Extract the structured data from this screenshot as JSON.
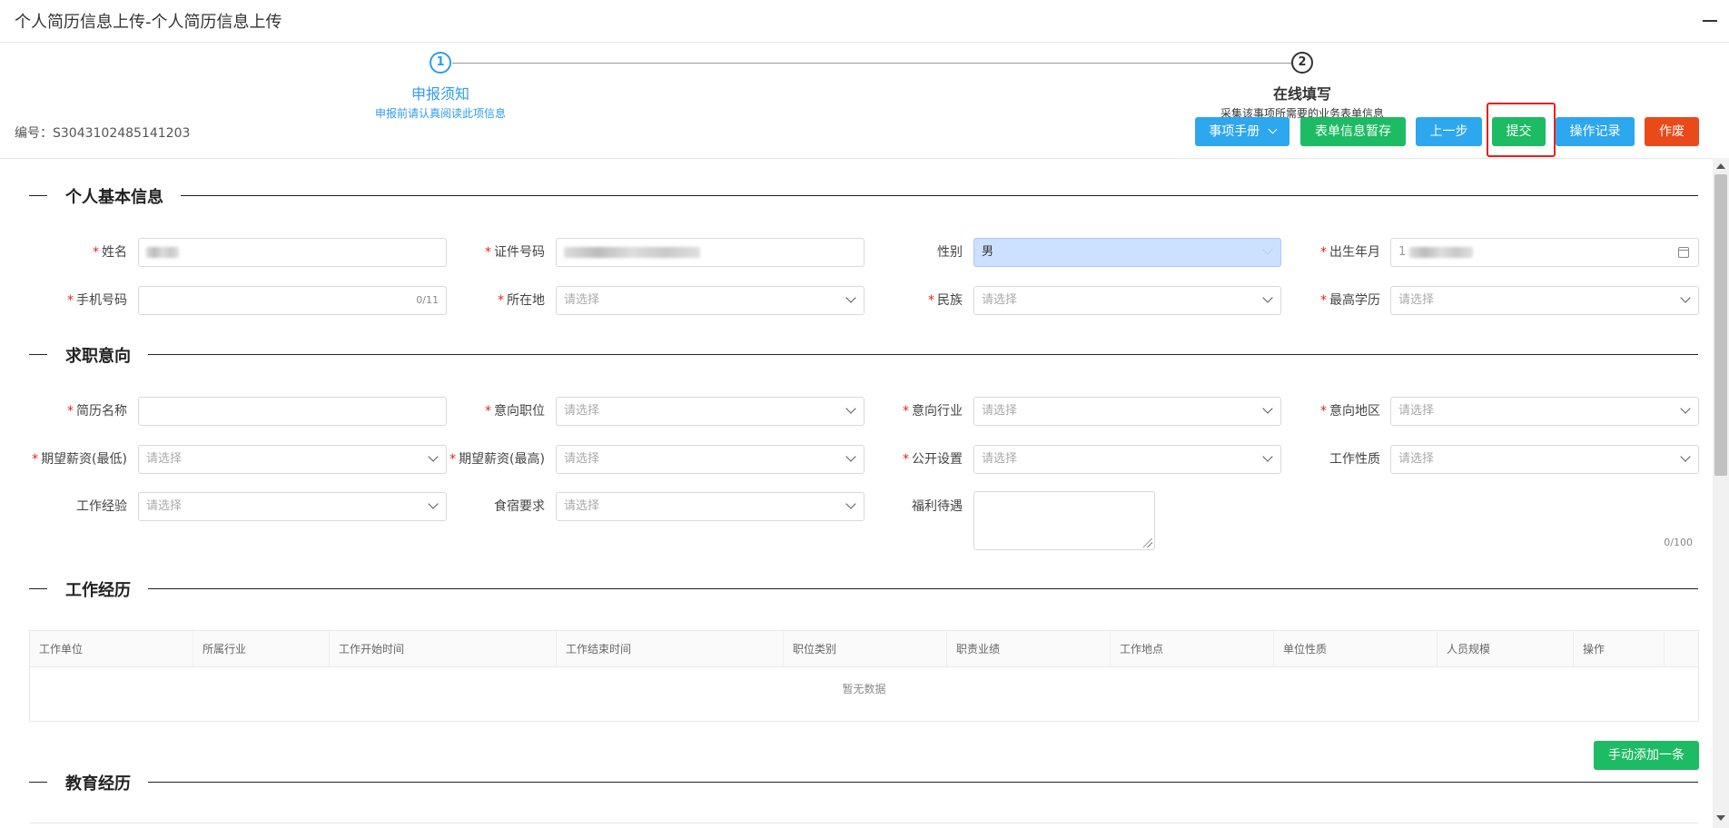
{
  "window": {
    "title": "个人简历信息上传-个人简历信息上传"
  },
  "steps": [
    {
      "num": "1",
      "title": "申报须知",
      "desc": "申报前请认真阅读此项信息"
    },
    {
      "num": "2",
      "title": "在线填写",
      "desc": "采集该事项所需要的业务表单信息"
    }
  ],
  "serial": "编号：S3043102485141203",
  "toolbar": {
    "manual": "事项手册",
    "save": "表单信息暂存",
    "prev": "上一步",
    "submit": "提交",
    "log": "操作记录",
    "void": "作废"
  },
  "placeholder": "请选择",
  "sections": {
    "basic": "个人基本信息",
    "intent": "求职意向",
    "work": "工作经历",
    "education": "教育经历"
  },
  "basic": {
    "name_label": "姓名",
    "id_label": "证件号码",
    "gender_label": "性别",
    "gender_value": "男",
    "birth_label": "出生年月",
    "birth_value": "1",
    "phone_label": "手机号码",
    "phone_count": "0/11",
    "location_label": "所在地",
    "ethnicity_label": "民族",
    "education_label": "最高学历"
  },
  "intent": {
    "resume_name_label": "简历名称",
    "position_label": "意向职位",
    "industry_label": "意向行业",
    "region_label": "意向地区",
    "salary_min_label": "期望薪资(最低)",
    "salary_max_label": "期望薪资(最高)",
    "public_label": "公开设置",
    "work_nature_label": "工作性质",
    "experience_label": "工作经验",
    "lodging_label": "食宿要求",
    "welfare_label": "福利待遇",
    "welfare_count": "0/100"
  },
  "work_table": {
    "columns": [
      "工作单位",
      "所属行业",
      "工作开始时间",
      "工作结束时间",
      "职位类别",
      "职责业绩",
      "工作地点",
      "单位性质",
      "人员规模",
      "操作"
    ],
    "empty": "暂无数据",
    "add_button": "手动添加一条"
  },
  "colors": {
    "blue": "#2da7ee",
    "green": "#1dbb63",
    "red": "#e84a1a",
    "step_active": "#2d9cf0"
  }
}
